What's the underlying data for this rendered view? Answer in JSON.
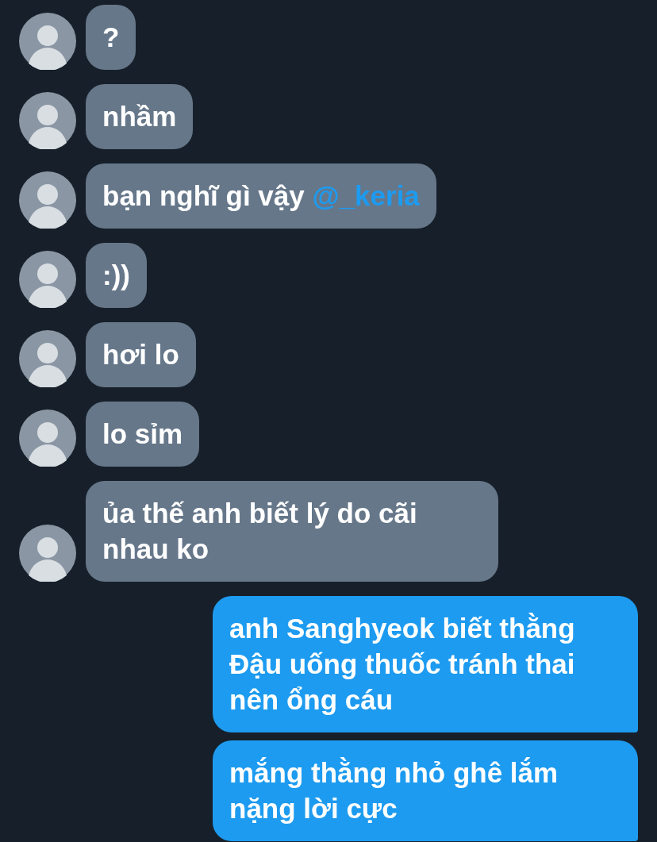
{
  "messages": [
    {
      "kind": "received",
      "text": "?"
    },
    {
      "kind": "received",
      "text": "nhầm"
    },
    {
      "kind": "received",
      "text": "bạn nghĩ gì vậy",
      "mention": "@_keria"
    },
    {
      "kind": "received",
      "text": ":))"
    },
    {
      "kind": "received",
      "text": "hơi lo"
    },
    {
      "kind": "received",
      "text": "lo sỉm"
    },
    {
      "kind": "received",
      "text": "ủa thế anh biết lý do cãi nhau ko"
    },
    {
      "kind": "sent",
      "text": "anh Sanghyeok biết thằng Đậu uống thuốc tránh thai nên ổng cáu"
    },
    {
      "kind": "sent",
      "text": "mắng thằng nhỏ ghê lắm nặng lời cực"
    }
  ]
}
